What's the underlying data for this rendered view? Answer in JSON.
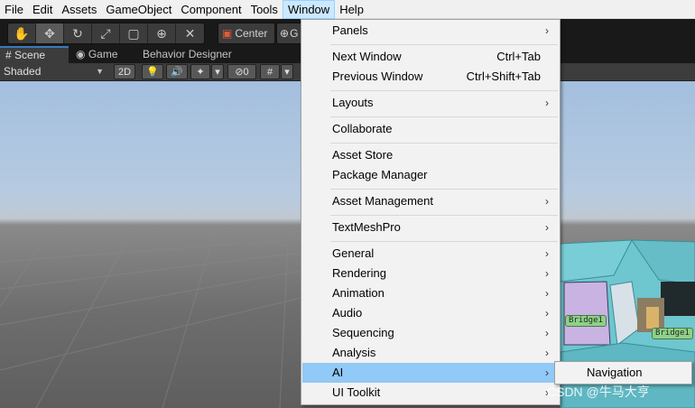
{
  "menubar": {
    "items": [
      "File",
      "Edit",
      "Assets",
      "GameObject",
      "Component",
      "Tools",
      "Window",
      "Help"
    ],
    "active": "Window"
  },
  "toolbar": {
    "tools": [
      "hand-icon",
      "move-icon",
      "rotate-icon",
      "scale-icon",
      "rect-icon",
      "transform-icon",
      "custom-tool-icon"
    ],
    "pivot_label": "Center",
    "global_label": "G"
  },
  "tabs": [
    {
      "label": "Scene",
      "icon": "grid-icon"
    },
    {
      "label": "Game",
      "icon": "gamepad-icon"
    },
    {
      "label": "Behavior Designer",
      "icon": ""
    }
  ],
  "scenebar": {
    "shading_mode": "Shaded",
    "mode_2d": "2D",
    "hidden_count": "0"
  },
  "dropdown": {
    "items": [
      {
        "label": "Panels",
        "submenu": true
      },
      {
        "label": "Next Window",
        "shortcut": "Ctrl+Tab"
      },
      {
        "label": "Previous Window",
        "shortcut": "Ctrl+Shift+Tab"
      },
      {
        "label": "Layouts",
        "submenu": true
      },
      {
        "label": "Collaborate"
      },
      {
        "label": "Asset Store"
      },
      {
        "label": "Package Manager"
      },
      {
        "label": "Asset Management",
        "submenu": true
      },
      {
        "label": "TextMeshPro",
        "submenu": true
      },
      {
        "label": "General",
        "submenu": true
      },
      {
        "label": "Rendering",
        "submenu": true
      },
      {
        "label": "Animation",
        "submenu": true
      },
      {
        "label": "Audio",
        "submenu": true
      },
      {
        "label": "Sequencing",
        "submenu": true
      },
      {
        "label": "Analysis",
        "submenu": true
      },
      {
        "label": "AI",
        "submenu": true,
        "highlighted": true
      },
      {
        "label": "UI Toolkit",
        "submenu": true
      }
    ],
    "submenu_arrow": "›"
  },
  "submenu": {
    "items": [
      "Navigation"
    ]
  },
  "scene": {
    "labels": [
      "Bridge1",
      "Bridge1"
    ]
  },
  "watermark": "CSDN @牛马大亨",
  "colors": {
    "highlight": "#91c9f7",
    "menubar_active": "#cce8ff",
    "navmesh": "#6ec6cf"
  }
}
